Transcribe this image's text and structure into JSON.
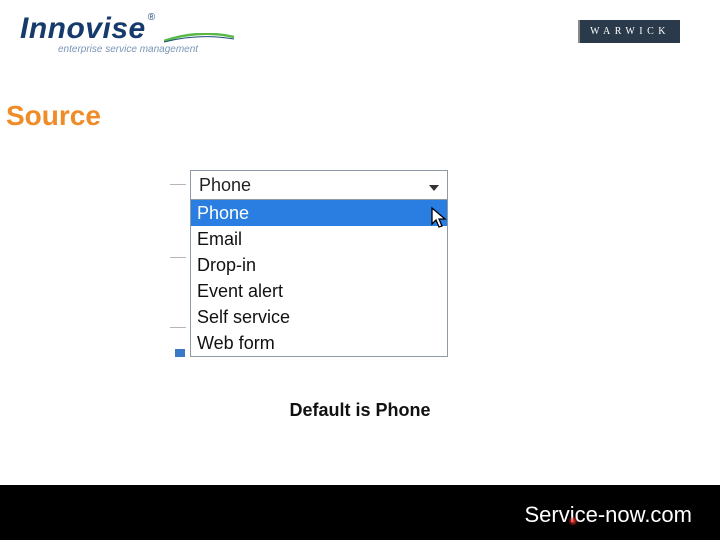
{
  "brand": {
    "name": "Innovise",
    "tagline": "enterprise service management",
    "partner": "WARWICK",
    "footer_logo_a": "Serv",
    "footer_logo_b": "ice-now",
    "footer_logo_c": ".com"
  },
  "page": {
    "title": "Source",
    "caption": "Default is Phone"
  },
  "dropdown": {
    "selected": "Phone",
    "options": [
      "Phone",
      "Email",
      "Drop-in",
      "Event alert",
      "Self service",
      "Web form"
    ],
    "highlighted_index": 0
  }
}
